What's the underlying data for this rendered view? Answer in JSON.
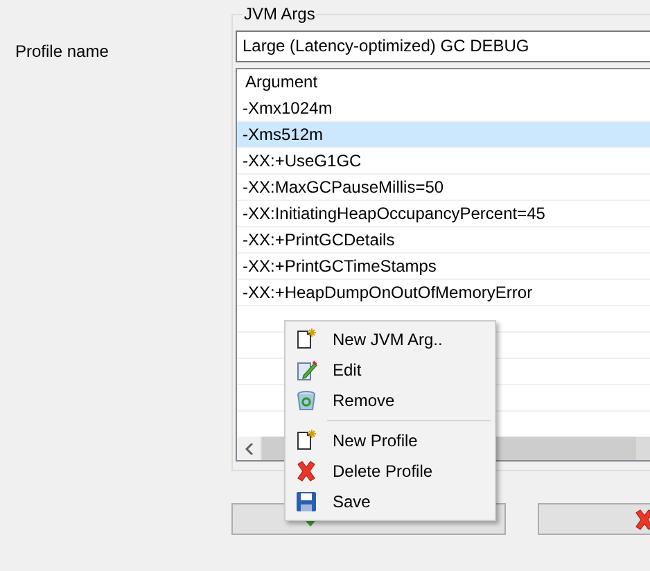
{
  "profile_name_label": "Profile name",
  "jvm_args": {
    "title": "JVM Args",
    "profile_value": "Large (Latency-optimized) GC DEBUG",
    "table": {
      "columns": [
        "Argument"
      ],
      "rows": [
        {
          "argument": "-Xmx1024m",
          "selected": false
        },
        {
          "argument": "-Xms512m",
          "selected": true
        },
        {
          "argument": "-XX:+UseG1GC",
          "selected": false
        },
        {
          "argument": "-XX:MaxGCPauseMillis=50",
          "selected": false
        },
        {
          "argument": "-XX:InitiatingHeapOccupancyPercent=45",
          "selected": false
        },
        {
          "argument": "-XX:+PrintGCDetails",
          "selected": false
        },
        {
          "argument": "-XX:+PrintGCTimeStamps",
          "selected": false
        },
        {
          "argument": "-XX:+HeapDumpOnOutOfMemoryError",
          "selected": false
        }
      ]
    }
  },
  "context_menu": [
    {
      "kind": "item",
      "label": "New JVM Arg.."
    },
    {
      "kind": "item",
      "label": "Edit"
    },
    {
      "kind": "item",
      "label": "Remove"
    },
    {
      "kind": "separator"
    },
    {
      "kind": "item",
      "label": "New Profile"
    },
    {
      "kind": "item",
      "label": "Delete Profile"
    },
    {
      "kind": "item",
      "label": "Save"
    }
  ]
}
